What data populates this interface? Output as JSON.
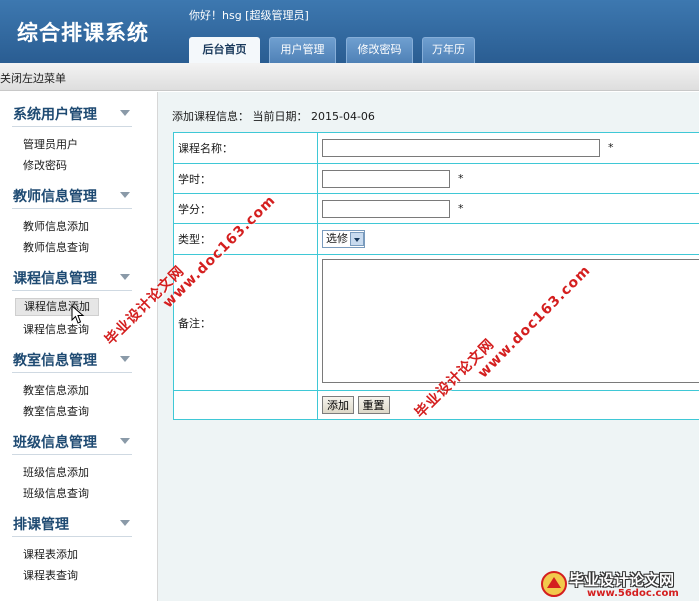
{
  "header": {
    "app_title": "综合排课系统",
    "greeting": "你好！hsg [超级管理员]",
    "tabs": [
      {
        "label": "后台首页",
        "active": true
      },
      {
        "label": "用户管理",
        "active": false
      },
      {
        "label": "修改密码",
        "active": false
      },
      {
        "label": "万年历",
        "active": false
      }
    ]
  },
  "toolbar": {
    "close_menu_label": "关闭左边菜单"
  },
  "sidebar": {
    "groups": [
      {
        "title": "系统用户管理",
        "items": [
          "管理员用户",
          "修改密码"
        ]
      },
      {
        "title": "教师信息管理",
        "items": [
          "教师信息添加",
          "教师信息查询"
        ]
      },
      {
        "title": "课程信息管理",
        "items": [
          "课程信息添加",
          "课程信息查询"
        ]
      },
      {
        "title": "教室信息管理",
        "items": [
          "教室信息添加",
          "教室信息查询"
        ]
      },
      {
        "title": "班级信息管理",
        "items": [
          "班级信息添加",
          "班级信息查询"
        ]
      },
      {
        "title": "排课管理",
        "items": [
          "课程表添加",
          "课程表查询"
        ]
      }
    ]
  },
  "main": {
    "heading": "添加课程信息：  当前日期：  2015-04-06",
    "form": {
      "course_name_label": "课程名称：",
      "hours_label": "学时：",
      "credits_label": "学分：",
      "type_label": "类型：",
      "type_selected": "选修",
      "remark_label": "备注：",
      "required_mark": "*",
      "course_name_value": "",
      "hours_value": "",
      "credits_value": "",
      "remark_value": "",
      "add_button": "添加",
      "reset_button": "重置"
    }
  },
  "watermarks": {
    "site_cn": "毕业设计论文网",
    "site_url": "www.doc163.com",
    "logo_text": "毕业设计论文网",
    "logo_url": "www.56doc.com"
  },
  "colors": {
    "header_blue": "#2a5d92",
    "table_border": "#3fc8d6",
    "watermark_red": "#d41f1f"
  },
  "icons": {
    "group_toggle": "chevron-down-icon",
    "cursor": "mouse-pointer-icon",
    "select_arrow": "dropdown-arrow-icon"
  }
}
